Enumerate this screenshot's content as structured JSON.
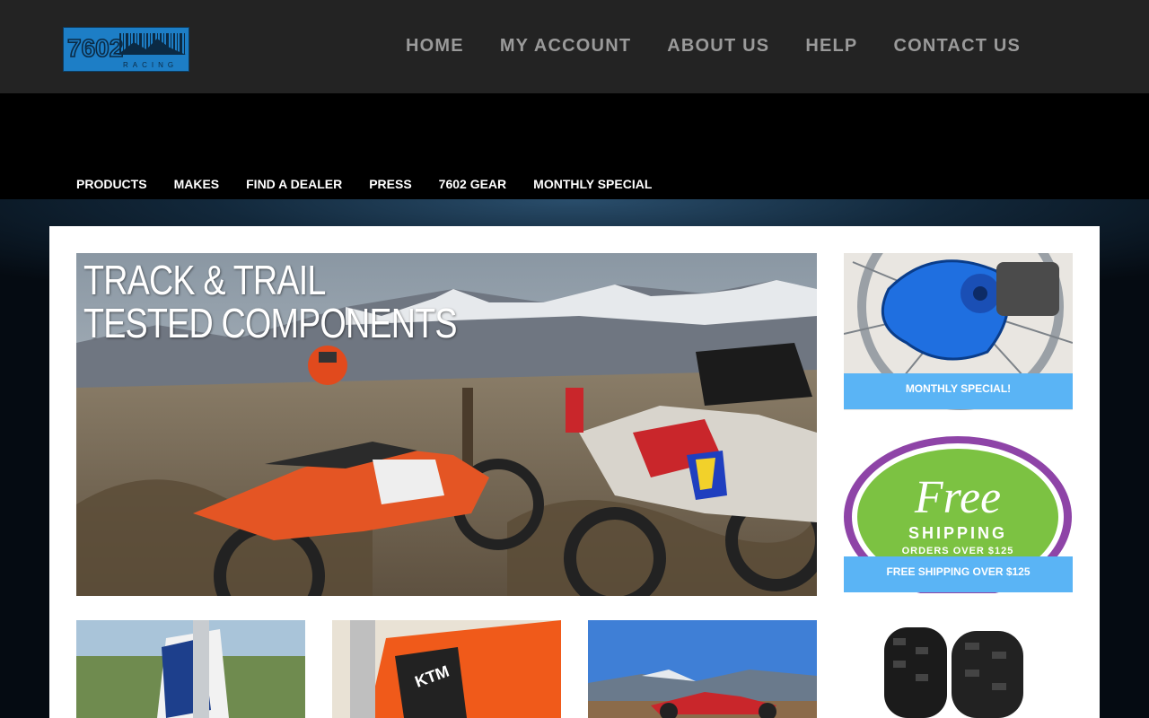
{
  "logo": {
    "text": "7602",
    "sub": "RACING"
  },
  "top_nav": [
    "HOME",
    "MY ACCOUNT",
    "ABOUT US",
    "HELP",
    "CONTACT US"
  ],
  "sub_nav": [
    "PRODUCTS",
    "MAKES",
    "FIND A DEALER",
    "PRESS",
    "7602 GEAR",
    "MONTHLY SPECIAL"
  ],
  "hero": {
    "line1": "TRACK & TRAIL",
    "line2": "TESTED COMPONENTS"
  },
  "side_cards": [
    {
      "caption": "MONTHLY SPECIAL!"
    },
    {
      "caption": "FREE SHIPPING OVER $125",
      "img_line1": "Free",
      "img_line2": "SHIPPING",
      "img_line3": "ORDERS OVER $125"
    }
  ],
  "colors": {
    "topbar": "#232323",
    "logo_blue": "#1d7ec6",
    "caption_blue": "#5ab4f5",
    "badge_purple": "#8e44a7",
    "badge_green": "#7cc242"
  }
}
